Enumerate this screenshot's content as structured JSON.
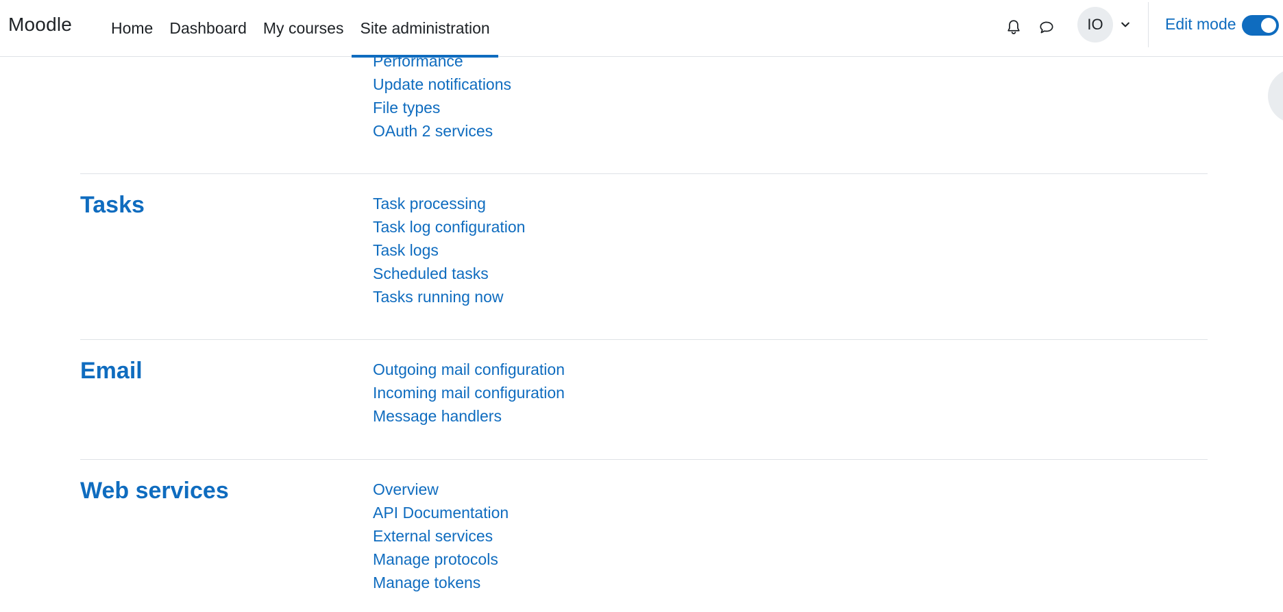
{
  "navbar": {
    "brand": "Moodle",
    "items": [
      {
        "label": "Home"
      },
      {
        "label": "Dashboard"
      },
      {
        "label": "My courses"
      },
      {
        "label": "Site administration",
        "active": true
      }
    ],
    "user_initials": "IO",
    "edit_mode_label": "Edit mode",
    "edit_mode_on": true,
    "icons": [
      "bell-icon",
      "chat-bubble-icon",
      "chevron-down-icon"
    ]
  },
  "colors": {
    "accent": "#0f6cbf",
    "text": "#1d2125",
    "border": "#dee2e6",
    "avatar_bg": "#e9ecef"
  },
  "sections": {
    "server_tail": {
      "links": [
        "Performance",
        "Update notifications",
        "File types",
        "OAuth 2 services"
      ]
    },
    "tasks": {
      "title": "Tasks",
      "links": [
        "Task processing",
        "Task log configuration",
        "Task logs",
        "Scheduled tasks",
        "Tasks running now"
      ]
    },
    "email": {
      "title": "Email",
      "links": [
        "Outgoing mail configuration",
        "Incoming mail configuration",
        "Message handlers"
      ]
    },
    "web_services": {
      "title": "Web services",
      "links": [
        "Overview",
        "API Documentation",
        "External services",
        "Manage protocols",
        "Manage tokens"
      ]
    }
  }
}
